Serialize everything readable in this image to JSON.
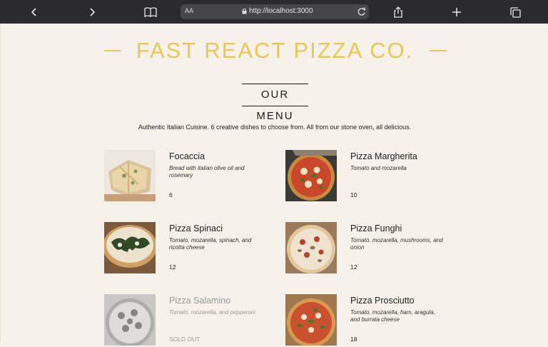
{
  "browser": {
    "url_aa": "AA",
    "url": "http://localhost:3000",
    "icons": {
      "back": "chevron-left-icon",
      "forward": "chevron-right-icon",
      "reader": "book-icon",
      "share": "share-icon",
      "new_tab": "plus-icon",
      "tabs": "tabs-icon",
      "lock": "lock-icon",
      "reload": "reload-icon"
    }
  },
  "header": {
    "brand": "FAST REACT PIZZA CO.",
    "brand_color": "#ecc654"
  },
  "menu": {
    "title": "OUR MENU",
    "subtitle": "Authentic Italian Cuisine. 6 creative dishes to choose from. All from our stone oven, all delicious.",
    "items": [
      {
        "name": "Focaccia",
        "ingredients": "Bread with italian olive oil and rosemary",
        "price": "6",
        "sold_out": false
      },
      {
        "name": "Pizza Margherita",
        "ingredients": "Tomato and mozarella",
        "price": "10",
        "sold_out": false
      },
      {
        "name": "Pizza Spinaci",
        "ingredients": "Tomato, mozarella, spinach, and ricotta cheese",
        "price": "12",
        "sold_out": false
      },
      {
        "name": "Pizza Funghi",
        "ingredients": "Tomato, mozarella, mushrooms, and onion",
        "price": "12",
        "sold_out": false
      },
      {
        "name": "Pizza Salamino",
        "ingredients": "Tomato, mozarella, and pepperoni",
        "price": "SOLD OUT",
        "sold_out": true
      },
      {
        "name": "Pizza Prosciutto",
        "ingredients": "Tomato, mozarella, ham, aragula, and burrata cheese",
        "price": "18",
        "sold_out": false
      }
    ]
  }
}
